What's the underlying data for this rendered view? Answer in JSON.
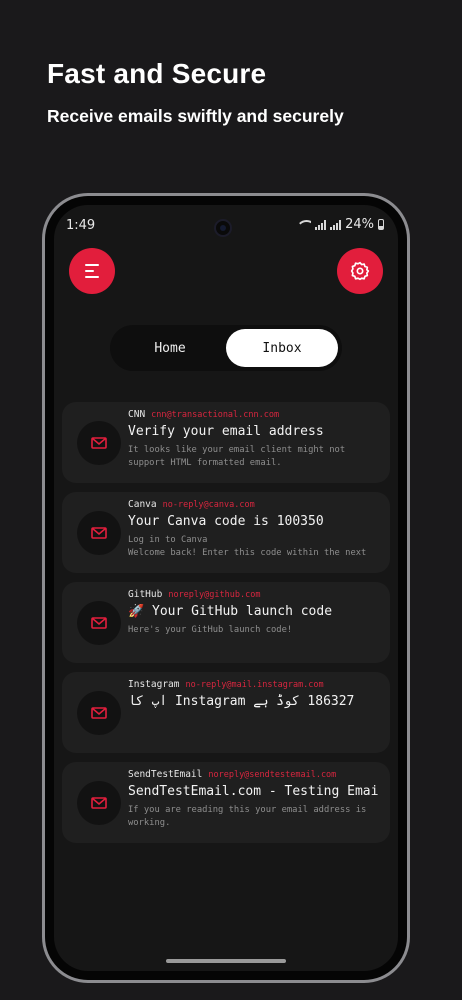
{
  "promo": {
    "headline": "Fast and Secure",
    "subhead": "Receive emails swiftly and securely"
  },
  "status_bar": {
    "time": "1:49",
    "battery": "24%"
  },
  "tabs": [
    {
      "label": "Home",
      "active": false
    },
    {
      "label": "Inbox",
      "active": true
    }
  ],
  "emails": [
    {
      "sender": "CNN",
      "address": "cnn@transactional.cnn.com",
      "subject": "Verify your email address",
      "preview": "It looks like your email client might not support HTML formatted email."
    },
    {
      "sender": "Canva",
      "address": "no-reply@canva.com",
      "subject": "Your Canva code is 100350",
      "preview": "Log in to Canva\nWelcome back! Enter this code within the next"
    },
    {
      "sender": "GitHub",
      "address": "noreply@github.com",
      "subject": "🚀 Your GitHub launch code",
      "preview": "Here's your GitHub launch code!"
    },
    {
      "sender": "Instagram",
      "address": "no-reply@mail.instagram.com",
      "subject": "186327 کوڈ ہے Instagram آپ کا",
      "preview": ""
    },
    {
      "sender": "SendTestEmail",
      "address": "noreply@sendtestemail.com",
      "subject": "SendTestEmail.com - Testing Email",
      "preview": "If you are reading this your email address is working."
    }
  ],
  "icons": {
    "menu": "menu-icon",
    "settings": "gear-icon",
    "email": "mail-icon"
  },
  "colors": {
    "accent": "#e21e3c",
    "background": "#1a191b",
    "card": "#1f1f1f"
  }
}
